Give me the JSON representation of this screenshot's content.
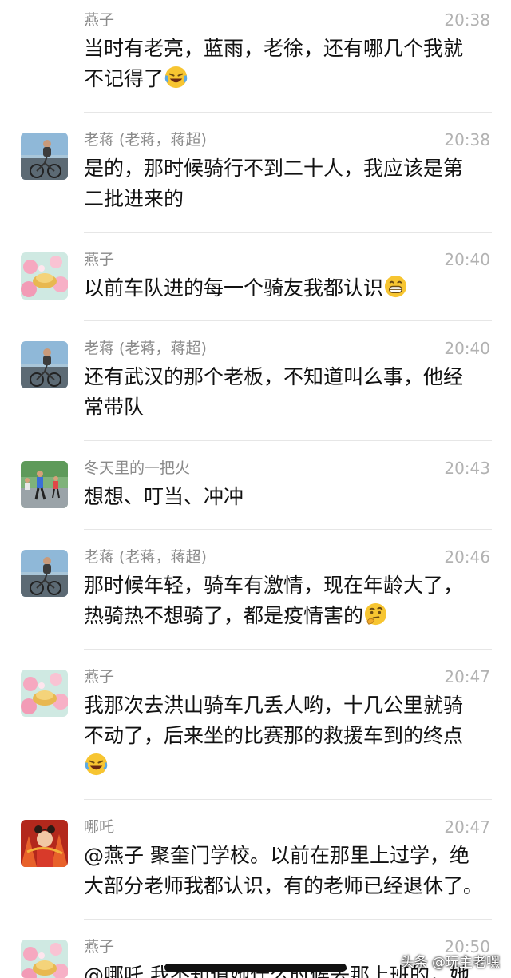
{
  "messages": [
    {
      "name": "燕子",
      "time": "20:38",
      "lines": [
        "当时有老亮，蓝雨，老徐，还有哪几个我就",
        "不记得了"
      ],
      "emoji": "laugh-cry-emoji",
      "avatar": "flowers-avatar"
    },
    {
      "name": "老蒋 (老蒋，蒋超)",
      "time": "20:38",
      "lines": [
        "是的，那时候骑行不到二十人，我应该是第",
        "二批进来的"
      ],
      "avatar": "cyclist-avatar"
    },
    {
      "name": "燕子",
      "time": "20:40",
      "lines": [
        "以前车队进的每一个骑友我都认识"
      ],
      "emoji": "grin-emoji",
      "avatar": "flowers-avatar"
    },
    {
      "name": "老蒋 (老蒋，蒋超)",
      "time": "20:40",
      "lines": [
        "还有武汉的那个老板，不知道叫么事，他经",
        "常带队"
      ],
      "avatar": "cyclist-avatar"
    },
    {
      "name": "冬天里的一把火",
      "time": "20:43",
      "lines": [
        "想想、叮当、冲冲"
      ],
      "avatar": "runners-avatar"
    },
    {
      "name": "老蒋 (老蒋，蒋超)",
      "time": "20:46",
      "lines": [
        "那时候年轻，骑车有激情，现在年龄大了，",
        "热骑热不想骑了，都是疫情害的"
      ],
      "emoji": "thinking-emoji",
      "avatar": "cyclist-avatar"
    },
    {
      "name": "燕子",
      "time": "20:47",
      "lines": [
        "我那次去洪山骑车几丢人哟，十几公里就骑",
        "不动了，后来坐的比赛那的救援车到的终点"
      ],
      "emoji": "laugh-cry-emoji",
      "avatar": "flowers-avatar"
    },
    {
      "name": "哪吒",
      "time": "20:47",
      "lines": [
        "@燕子 聚奎门学校。以前在那里上过学，绝",
        "大部分老师我都认识，有的老师已经退休了。"
      ],
      "avatar": "nezha-avatar"
    },
    {
      "name": "燕子",
      "time": "20:50",
      "lines": [
        "@哪吒 我不知道她什么时候去那上班的，她"
      ],
      "avatar": "flowers-avatar"
    }
  ],
  "watermark": "头条 @玩主老嘿"
}
